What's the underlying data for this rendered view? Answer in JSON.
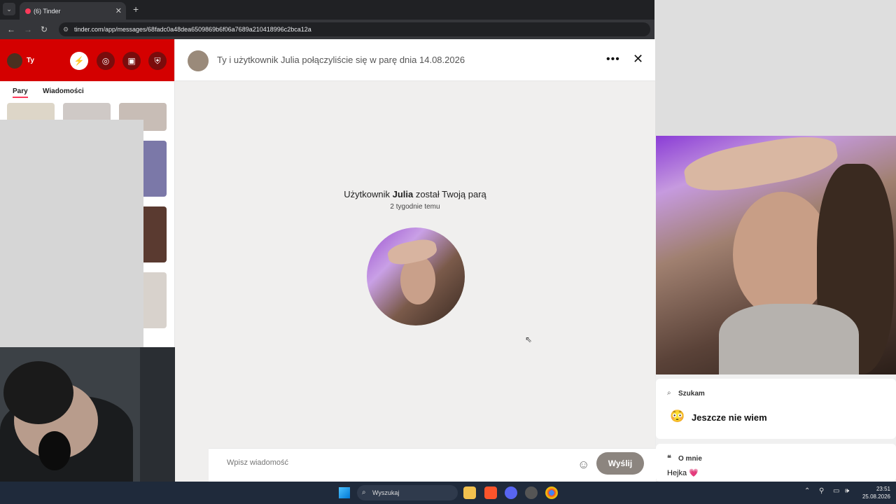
{
  "browser": {
    "tab_title": "(6) Tinder",
    "tab_close": "✕",
    "new_tab": "+",
    "url": "tinder.com/app/messages/68fadc0a48dea6509869b6f06a7689a210418996c2bca12a"
  },
  "sidebar": {
    "user_name": "Ty",
    "tabs": [
      "Pary",
      "Wiadomości"
    ]
  },
  "chat": {
    "header_title": "Ty i użytkownik Julia połączyliście się w parę dnia 14.08.2026",
    "dots": "•••",
    "close": "✕",
    "match_prefix": "Użytkownik ",
    "match_name": "Julia",
    "match_suffix": " został Twoją parą",
    "match_time": "2 tygodnie temu",
    "input_placeholder": "Wpisz wiadomość",
    "send_label": "Wyślij"
  },
  "profile": {
    "looking_label": "Szukam",
    "looking_value": "Jeszcze nie wiem",
    "looking_emoji": "😳",
    "about_label": "O mnie",
    "about_value": "Hejka 💗"
  },
  "taskbar": {
    "search_label": "Wyszukaj",
    "time": "23:51",
    "date": "25.08.2026"
  },
  "colors": {
    "brand": "#fd3a5a",
    "header_red": "#d40000",
    "send_button": "#8c857f",
    "taskbar": "#1f2a3b"
  }
}
